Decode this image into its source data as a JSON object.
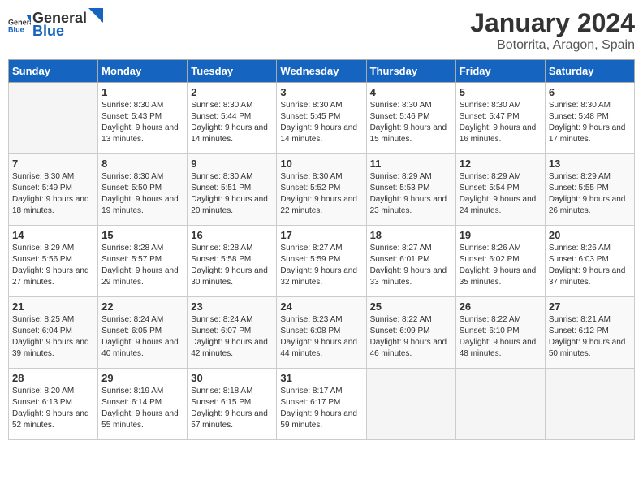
{
  "logo": {
    "general": "General",
    "blue": "Blue"
  },
  "title": {
    "month_year": "January 2024",
    "location": "Botorrita, Aragon, Spain"
  },
  "days_of_week": [
    "Sunday",
    "Monday",
    "Tuesday",
    "Wednesday",
    "Thursday",
    "Friday",
    "Saturday"
  ],
  "weeks": [
    [
      {
        "day": "",
        "sunrise": "",
        "sunset": "",
        "daylight": ""
      },
      {
        "day": "1",
        "sunrise": "Sunrise: 8:30 AM",
        "sunset": "Sunset: 5:43 PM",
        "daylight": "Daylight: 9 hours and 13 minutes."
      },
      {
        "day": "2",
        "sunrise": "Sunrise: 8:30 AM",
        "sunset": "Sunset: 5:44 PM",
        "daylight": "Daylight: 9 hours and 14 minutes."
      },
      {
        "day": "3",
        "sunrise": "Sunrise: 8:30 AM",
        "sunset": "Sunset: 5:45 PM",
        "daylight": "Daylight: 9 hours and 14 minutes."
      },
      {
        "day": "4",
        "sunrise": "Sunrise: 8:30 AM",
        "sunset": "Sunset: 5:46 PM",
        "daylight": "Daylight: 9 hours and 15 minutes."
      },
      {
        "day": "5",
        "sunrise": "Sunrise: 8:30 AM",
        "sunset": "Sunset: 5:47 PM",
        "daylight": "Daylight: 9 hours and 16 minutes."
      },
      {
        "day": "6",
        "sunrise": "Sunrise: 8:30 AM",
        "sunset": "Sunset: 5:48 PM",
        "daylight": "Daylight: 9 hours and 17 minutes."
      }
    ],
    [
      {
        "day": "7",
        "sunrise": "Sunrise: 8:30 AM",
        "sunset": "Sunset: 5:49 PM",
        "daylight": "Daylight: 9 hours and 18 minutes."
      },
      {
        "day": "8",
        "sunrise": "Sunrise: 8:30 AM",
        "sunset": "Sunset: 5:50 PM",
        "daylight": "Daylight: 9 hours and 19 minutes."
      },
      {
        "day": "9",
        "sunrise": "Sunrise: 8:30 AM",
        "sunset": "Sunset: 5:51 PM",
        "daylight": "Daylight: 9 hours and 20 minutes."
      },
      {
        "day": "10",
        "sunrise": "Sunrise: 8:30 AM",
        "sunset": "Sunset: 5:52 PM",
        "daylight": "Daylight: 9 hours and 22 minutes."
      },
      {
        "day": "11",
        "sunrise": "Sunrise: 8:29 AM",
        "sunset": "Sunset: 5:53 PM",
        "daylight": "Daylight: 9 hours and 23 minutes."
      },
      {
        "day": "12",
        "sunrise": "Sunrise: 8:29 AM",
        "sunset": "Sunset: 5:54 PM",
        "daylight": "Daylight: 9 hours and 24 minutes."
      },
      {
        "day": "13",
        "sunrise": "Sunrise: 8:29 AM",
        "sunset": "Sunset: 5:55 PM",
        "daylight": "Daylight: 9 hours and 26 minutes."
      }
    ],
    [
      {
        "day": "14",
        "sunrise": "Sunrise: 8:29 AM",
        "sunset": "Sunset: 5:56 PM",
        "daylight": "Daylight: 9 hours and 27 minutes."
      },
      {
        "day": "15",
        "sunrise": "Sunrise: 8:28 AM",
        "sunset": "Sunset: 5:57 PM",
        "daylight": "Daylight: 9 hours and 29 minutes."
      },
      {
        "day": "16",
        "sunrise": "Sunrise: 8:28 AM",
        "sunset": "Sunset: 5:58 PM",
        "daylight": "Daylight: 9 hours and 30 minutes."
      },
      {
        "day": "17",
        "sunrise": "Sunrise: 8:27 AM",
        "sunset": "Sunset: 5:59 PM",
        "daylight": "Daylight: 9 hours and 32 minutes."
      },
      {
        "day": "18",
        "sunrise": "Sunrise: 8:27 AM",
        "sunset": "Sunset: 6:01 PM",
        "daylight": "Daylight: 9 hours and 33 minutes."
      },
      {
        "day": "19",
        "sunrise": "Sunrise: 8:26 AM",
        "sunset": "Sunset: 6:02 PM",
        "daylight": "Daylight: 9 hours and 35 minutes."
      },
      {
        "day": "20",
        "sunrise": "Sunrise: 8:26 AM",
        "sunset": "Sunset: 6:03 PM",
        "daylight": "Daylight: 9 hours and 37 minutes."
      }
    ],
    [
      {
        "day": "21",
        "sunrise": "Sunrise: 8:25 AM",
        "sunset": "Sunset: 6:04 PM",
        "daylight": "Daylight: 9 hours and 39 minutes."
      },
      {
        "day": "22",
        "sunrise": "Sunrise: 8:24 AM",
        "sunset": "Sunset: 6:05 PM",
        "daylight": "Daylight: 9 hours and 40 minutes."
      },
      {
        "day": "23",
        "sunrise": "Sunrise: 8:24 AM",
        "sunset": "Sunset: 6:07 PM",
        "daylight": "Daylight: 9 hours and 42 minutes."
      },
      {
        "day": "24",
        "sunrise": "Sunrise: 8:23 AM",
        "sunset": "Sunset: 6:08 PM",
        "daylight": "Daylight: 9 hours and 44 minutes."
      },
      {
        "day": "25",
        "sunrise": "Sunrise: 8:22 AM",
        "sunset": "Sunset: 6:09 PM",
        "daylight": "Daylight: 9 hours and 46 minutes."
      },
      {
        "day": "26",
        "sunrise": "Sunrise: 8:22 AM",
        "sunset": "Sunset: 6:10 PM",
        "daylight": "Daylight: 9 hours and 48 minutes."
      },
      {
        "day": "27",
        "sunrise": "Sunrise: 8:21 AM",
        "sunset": "Sunset: 6:12 PM",
        "daylight": "Daylight: 9 hours and 50 minutes."
      }
    ],
    [
      {
        "day": "28",
        "sunrise": "Sunrise: 8:20 AM",
        "sunset": "Sunset: 6:13 PM",
        "daylight": "Daylight: 9 hours and 52 minutes."
      },
      {
        "day": "29",
        "sunrise": "Sunrise: 8:19 AM",
        "sunset": "Sunset: 6:14 PM",
        "daylight": "Daylight: 9 hours and 55 minutes."
      },
      {
        "day": "30",
        "sunrise": "Sunrise: 8:18 AM",
        "sunset": "Sunset: 6:15 PM",
        "daylight": "Daylight: 9 hours and 57 minutes."
      },
      {
        "day": "31",
        "sunrise": "Sunrise: 8:17 AM",
        "sunset": "Sunset: 6:17 PM",
        "daylight": "Daylight: 9 hours and 59 minutes."
      },
      {
        "day": "",
        "sunrise": "",
        "sunset": "",
        "daylight": ""
      },
      {
        "day": "",
        "sunrise": "",
        "sunset": "",
        "daylight": ""
      },
      {
        "day": "",
        "sunrise": "",
        "sunset": "",
        "daylight": ""
      }
    ]
  ]
}
